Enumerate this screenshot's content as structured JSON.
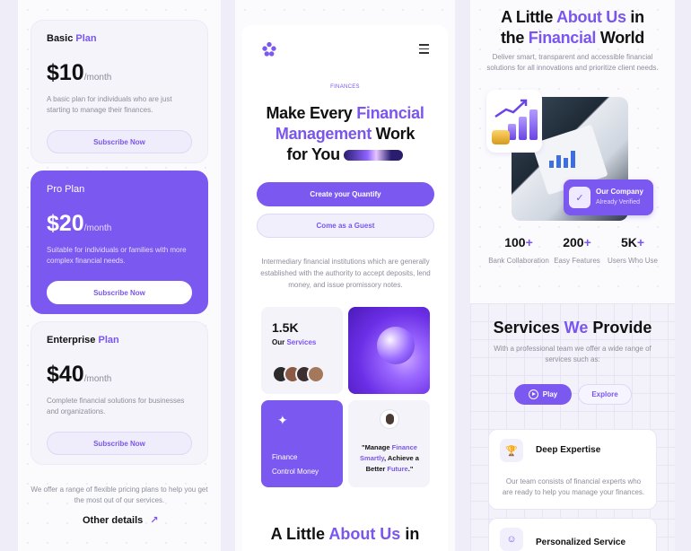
{
  "pricing": {
    "plans": [
      {
        "name_main": "Basic",
        "name_accent": " Plan",
        "price": "$10",
        "period": "/month",
        "desc": "A basic plan for individuals who are just starting to manage their finances.",
        "button": "Subscribe Now"
      },
      {
        "name_main": "Pro Plan",
        "name_accent": "",
        "price": "$20",
        "period": "/month",
        "desc": "Suitable for individuals or families with more complex financial needs.",
        "button": "Subscribe Now"
      },
      {
        "name_main": "Enterprise",
        "name_accent": " Plan",
        "price": "$40",
        "period": "/month",
        "desc": "Complete financial solutions for businesses and organizations.",
        "button": "Subscribe Now"
      }
    ],
    "note": "We offer a range of flexible pricing plans to help you get the most out of our services.",
    "link": "Other details",
    "link_icon": "arrow-up-right-icon"
  },
  "landing": {
    "tag": "FINANCES",
    "hero": {
      "l1a": "Make Every ",
      "l1b": "Financial",
      "l2a": "Management",
      "l2b": " Work",
      "l3": "for You"
    },
    "cta_primary": "Create your Quantify",
    "cta_secondary": "Come as a Guest",
    "intro": "Intermediary financial institutions which are generally established with the authority to accept deposits, lend money, and issue promissory notes.",
    "stat_tile": {
      "value": "1.5K",
      "label_a": "Our ",
      "label_b": "Services"
    },
    "feature_tile": {
      "line1": "Finance",
      "line2": "Control Money"
    },
    "quote": {
      "a": "\"Manage ",
      "b": "Finance",
      "c": "Smartly",
      "d": ", Achieve a Better ",
      "e": "Future",
      "f": ".\""
    },
    "bottom": {
      "a": "A Little ",
      "b": "About Us",
      "c": " in"
    }
  },
  "about": {
    "title": {
      "a": "A Little ",
      "b": "About Us",
      "c": " in",
      "d": "the ",
      "e": "Financial",
      "f": " World"
    },
    "subtitle": "Deliver smart, transparent and accessible financial solutions for all innovations and prioritize client needs.",
    "company": {
      "name": "Our Company",
      "status": "Already Verified"
    },
    "stats": [
      {
        "value": "100",
        "plus": "+",
        "label": "Bank Collaboration"
      },
      {
        "value": "200",
        "plus": "+",
        "label": "Easy Features"
      },
      {
        "value": "5K",
        "plus": "+",
        "label": "Users Who Use"
      }
    ]
  },
  "services": {
    "title": {
      "a": "Services ",
      "b": "We",
      "c": " Provide"
    },
    "subtitle": "With a professional team we offer a wide range of services such as:",
    "play": "Play",
    "explore": "Explore",
    "items": [
      {
        "title": "Deep Expertise",
        "desc": "Our team consists of financial experts who are ready to help you manage your finances.",
        "icon": "trophy-icon"
      },
      {
        "title": "Personalized Service",
        "desc": "",
        "icon": "smile-icon"
      }
    ]
  },
  "colors": {
    "accent": "#7b58f0",
    "text": "#111111",
    "muted": "#8e8e9c"
  }
}
